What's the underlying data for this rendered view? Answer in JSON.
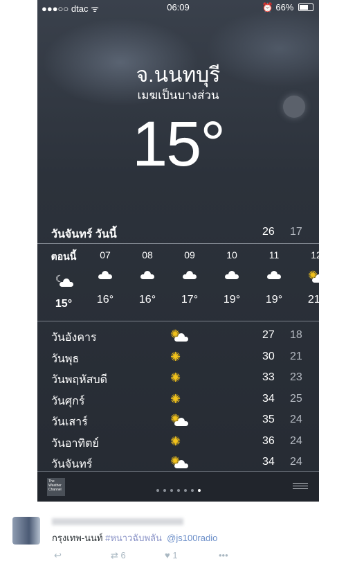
{
  "status": {
    "carrier": "●●●○○ dtac",
    "wifi": "ᯤ",
    "time": "06:09",
    "alarm": "⏰",
    "battery": "66%"
  },
  "location": {
    "city": "จ.นนทบุรี",
    "condition": "เมฆเป็นบางส่วน",
    "temp": "15°"
  },
  "today": {
    "day": "วันจันทร์",
    "label": "วันนี้",
    "high": "26",
    "low": "17"
  },
  "hourly": [
    {
      "hour": "ตอนนี้",
      "icon": "moon-cloud",
      "temp": "15°"
    },
    {
      "hour": "07",
      "icon": "cloud",
      "temp": "16°"
    },
    {
      "hour": "08",
      "icon": "cloud",
      "temp": "16°"
    },
    {
      "hour": "09",
      "icon": "cloud",
      "temp": "17°"
    },
    {
      "hour": "10",
      "icon": "cloud",
      "temp": "19°"
    },
    {
      "hour": "11",
      "icon": "cloud",
      "temp": "19°"
    },
    {
      "hour": "12",
      "icon": "sun-cloud",
      "temp": "21°"
    }
  ],
  "daily": [
    {
      "day": "วันอังคาร",
      "icon": "sun-cloud",
      "high": "27",
      "low": "18"
    },
    {
      "day": "วันพุธ",
      "icon": "sun",
      "high": "30",
      "low": "21"
    },
    {
      "day": "วันพฤหัสบดี",
      "icon": "sun",
      "high": "33",
      "low": "23"
    },
    {
      "day": "วันศุกร์",
      "icon": "sun",
      "high": "34",
      "low": "25"
    },
    {
      "day": "วันเสาร์",
      "icon": "sun-cloud",
      "high": "35",
      "low": "24"
    },
    {
      "day": "วันอาทิตย์",
      "icon": "sun",
      "high": "36",
      "low": "24"
    },
    {
      "day": "วันจันทร์",
      "icon": "sun-cloud",
      "high": "34",
      "low": "24"
    }
  ],
  "bottombar": {
    "logo_text": "The Weather Channel",
    "page_count": 7,
    "active_page": 7
  },
  "tweet": {
    "text_main": "กรุงเทพ-นนท์",
    "hashtag": "#หนาวฉับพลัน",
    "mention": "@js100radio",
    "retweets": "6",
    "likes": "1"
  },
  "colors": {
    "sun": "#f2c21b",
    "hashtag": "#8a93c7",
    "mention": "#6c8fc9"
  }
}
